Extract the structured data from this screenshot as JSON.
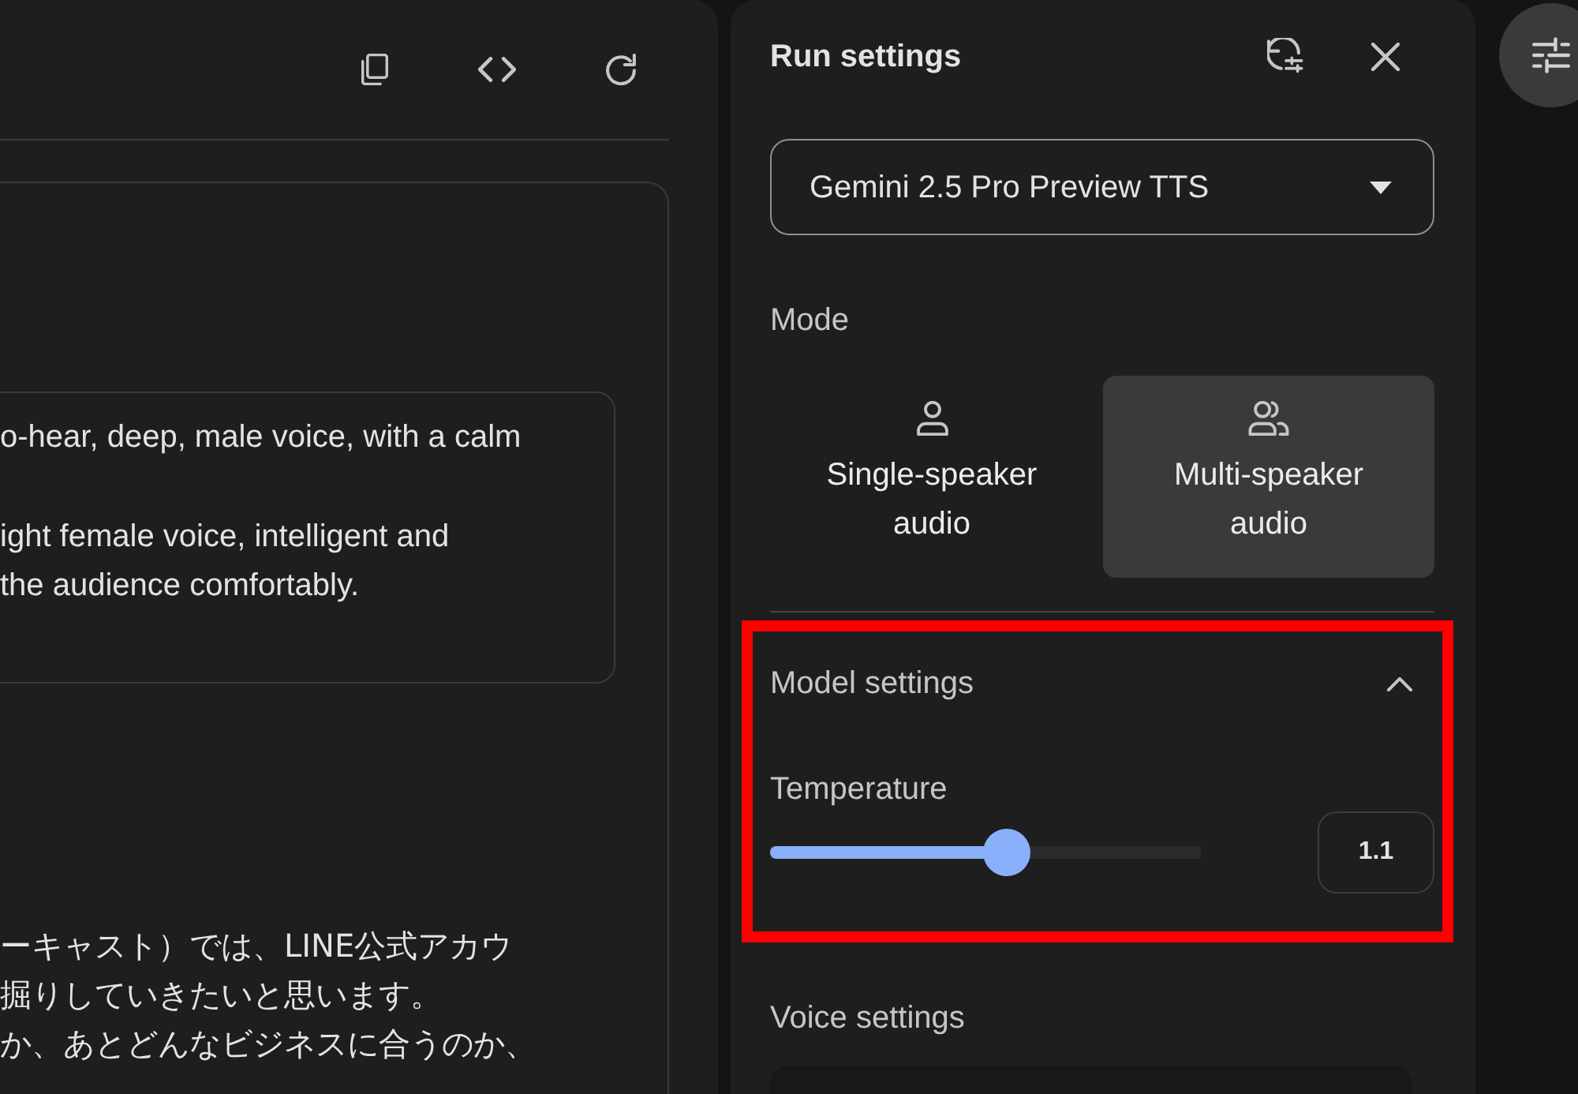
{
  "editor": {
    "instructions": {
      "paragraphs": [
        {
          "lines": [
            "o-hear, deep, male voice, with a calm"
          ]
        },
        {
          "lines": [
            "ight female voice, intelligent and",
            "the audience comfortably."
          ]
        }
      ]
    },
    "transcript": {
      "lines": [
        "ーキャスト）では、LINE公式アカウ",
        "掘りしていきたいと思います。",
        "か、あとどんなビジネスに合うのか、"
      ]
    }
  },
  "run_settings": {
    "title": "Run settings",
    "model": {
      "value": "Gemini 2.5 Pro Preview TTS"
    },
    "mode": {
      "label": "Mode",
      "options": [
        {
          "label": "Single-speaker audio",
          "kind": "single",
          "selected": false
        },
        {
          "label": "Multi-speaker audio",
          "kind": "multi",
          "selected": true
        }
      ]
    },
    "model_settings": {
      "title": "Model settings",
      "expanded": true,
      "highlighted": true,
      "temperature": {
        "label": "Temperature",
        "level": 0.55,
        "value": "1.1"
      }
    },
    "voice_settings": {
      "title": "Voice settings"
    }
  }
}
